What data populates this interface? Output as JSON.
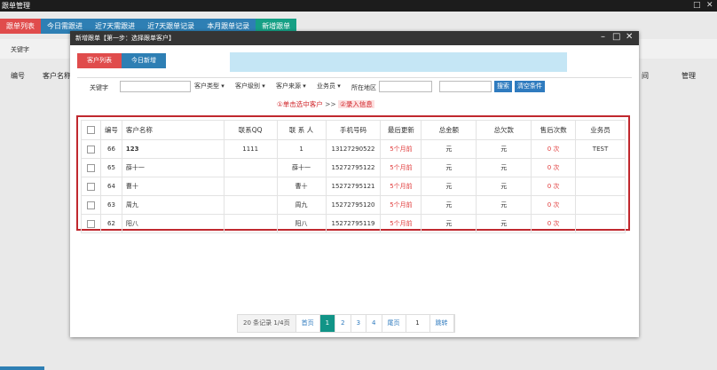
{
  "app": {
    "title": "跟单管理"
  },
  "outer": {
    "tabs": [
      {
        "label": "跟单列表",
        "color": "#e04c4c"
      },
      {
        "label": "今日需跟进",
        "color": "#2e7fb4"
      },
      {
        "label": "近7天需跟进",
        "color": "#2e7fb4"
      },
      {
        "label": "近7天跟单记录",
        "color": "#2e7fb4"
      },
      {
        "label": "本月跟单记录",
        "color": "#2e7fb4"
      },
      {
        "label": "新增跟单",
        "color": "#16a085"
      }
    ],
    "search_label": "关键字",
    "columns": {
      "c1": "编号",
      "c2": "客户名称",
      "c3": "间",
      "c4": "管理"
    }
  },
  "modal": {
    "title": "新增跟单【第一步：选择跟单客户】",
    "controls": {
      "minimize": "–",
      "maximize": "□",
      "close": "✕"
    },
    "tabs": [
      {
        "label": "客户列表",
        "color": "#e04c4c"
      },
      {
        "label": "今日新增",
        "color": "#2e7fb4"
      }
    ],
    "filter": {
      "keyword_label": "关键字",
      "keyword_value": "",
      "customer_type": "客户类型",
      "customer_level": "客户级别",
      "customer_source": "客户来源",
      "salesman": "业务员",
      "region_label": "所在地区",
      "search_button": "搜索",
      "clear_button": "清空条件"
    },
    "steps": {
      "step1": "①单击选中客户",
      "sep": ">>",
      "step2": "②录入信息"
    },
    "table": {
      "headers": [
        "编号",
        "客户名称",
        "联系QQ",
        "联 系 人",
        "手机号码",
        "最后更新",
        "总金额",
        "总欠款",
        "售后次数",
        "业务员"
      ],
      "rows": [
        {
          "id": "66",
          "name": "123",
          "qq": "1111",
          "contact": "1",
          "phone": "13127290522",
          "updated": "5个月前",
          "total": "元",
          "owed": "元",
          "aftersale": "0 次",
          "sales": "TEST"
        },
        {
          "id": "65",
          "name": "薛十一",
          "qq": "",
          "contact": "薛十一",
          "phone": "15272795122",
          "updated": "5个月前",
          "total": "元",
          "owed": "元",
          "aftersale": "0 次",
          "sales": ""
        },
        {
          "id": "64",
          "name": "曹十",
          "qq": "",
          "contact": "曹十",
          "phone": "15272795121",
          "updated": "5个月前",
          "total": "元",
          "owed": "元",
          "aftersale": "0 次",
          "sales": ""
        },
        {
          "id": "63",
          "name": "周九",
          "qq": "",
          "contact": "周九",
          "phone": "15272795120",
          "updated": "5个月前",
          "total": "元",
          "owed": "元",
          "aftersale": "0 次",
          "sales": ""
        },
        {
          "id": "62",
          "name": "阳八",
          "qq": "",
          "contact": "阳八",
          "phone": "15272795119",
          "updated": "5个月前",
          "total": "元",
          "owed": "元",
          "aftersale": "0 次",
          "sales": ""
        }
      ]
    },
    "pagination": {
      "info": "20 条记录 1/4页",
      "first": "首页",
      "pages": [
        "1",
        "2",
        "3",
        "4"
      ],
      "current": "1",
      "last": "尾页",
      "jump_value": "1",
      "jump": "跳转"
    }
  }
}
